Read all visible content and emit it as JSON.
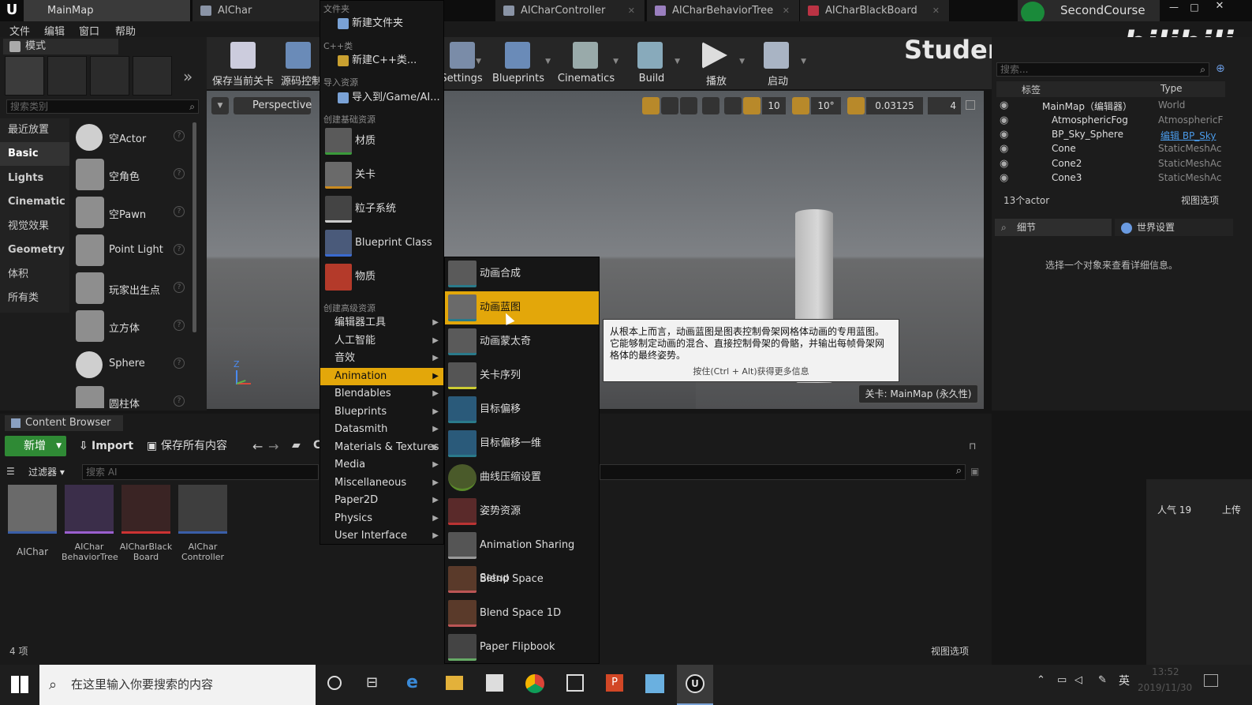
{
  "tabs": [
    {
      "label": "MainMap"
    },
    {
      "label": "AIChar"
    },
    {
      "label": "AICharController"
    },
    {
      "label": "AICharBehaviorTree"
    },
    {
      "label": "AICharBlackBoard"
    }
  ],
  "project_name": "SecondCourse",
  "menubar": {
    "file": "文件",
    "edit": "编辑",
    "window": "窗口",
    "help": "帮助"
  },
  "modes": {
    "title": "模式",
    "search_placeholder": "搜索类别",
    "categories": [
      "最近放置",
      "Basic",
      "Lights",
      "Cinematic",
      "视觉效果",
      "Geometry",
      "体积",
      "所有类"
    ],
    "items": [
      "空Actor",
      "空角色",
      "空Pawn",
      "Point Light",
      "玩家出生点",
      "立方体",
      "Sphere",
      "圆柱体"
    ]
  },
  "toolbar": {
    "buttons": [
      "保存当前关卡",
      "源码控制",
      "Settings",
      "Blueprints",
      "Cinematics",
      "Build",
      "播放",
      "启动"
    ]
  },
  "viewport": {
    "perspective": "Perspective",
    "grid_snap": "10",
    "rot_snap": "10°",
    "scale_snap": "0.03125",
    "cam_speed": "4",
    "level_label": "关卡: MainMap (永久性)",
    "axis_z": "Z"
  },
  "watermark": {
    "name": "StudentLittleRed",
    "brand": "bilibili"
  },
  "outliner": {
    "search_placeholder": "搜索...",
    "col_label": "标签",
    "col_type": "Type",
    "rows": [
      {
        "label": "MainMap（编辑器）",
        "type": "World"
      },
      {
        "label": "AtmosphericFog",
        "type": "AtmosphericF"
      },
      {
        "label": "BP_Sky_Sphere",
        "type": "编辑 BP_Sky"
      },
      {
        "label": "Cone",
        "type": "StaticMeshAc"
      },
      {
        "label": "Cone2",
        "type": "StaticMeshAc"
      },
      {
        "label": "Cone3",
        "type": "StaticMeshAc"
      }
    ],
    "count": "13个actor",
    "view_options": "视图选项"
  },
  "details": {
    "tab1": "细节",
    "tab2": "世界设置",
    "empty_msg": "选择一个对象来查看详细信息。",
    "popularity": "人气 19",
    "upload": "上传"
  },
  "content_browser": {
    "title": "Content Browser",
    "add_new": "新增",
    "import": "Import",
    "save_all": "保存所有内容",
    "filters": "过滤器",
    "search_placeholder": "搜索 AI",
    "path": "C",
    "assets": [
      {
        "name": "AIChar"
      },
      {
        "name": "AIChar BehaviorTree"
      },
      {
        "name": "AICharBlack Board"
      },
      {
        "name": "AIChar Controller"
      }
    ],
    "item_count": "4 项",
    "view_options": "视图选项"
  },
  "menu1": {
    "sec_folder": "文件夹",
    "new_folder": "新建文件夹",
    "sec_cpp": "C++类",
    "new_cpp": "新建C++类...",
    "sec_import": "导入资源",
    "import_to": "导入到/Game/AI...",
    "sec_basic": "创建基础资源",
    "basic": [
      "材质",
      "关卡",
      "粒子系统",
      "Blueprint Class",
      "物质"
    ],
    "sec_advanced": "创建高级资源",
    "advanced": [
      "编辑器工具",
      "人工智能",
      "音效",
      "Animation",
      "Blendables",
      "Blueprints",
      "Datasmith",
      "Materials & Textures",
      "Media",
      "Miscellaneous",
      "Paper2D",
      "Physics",
      "User Interface"
    ]
  },
  "menu2": {
    "items": [
      "动画合成",
      "动画蓝图",
      "动画蒙太奇",
      "关卡序列",
      "目标偏移",
      "目标偏移一维",
      "曲线压缩设置",
      "姿势资源",
      "Animation Sharing Setup",
      "Blend Space",
      "Blend Space 1D",
      "Paper Flipbook"
    ]
  },
  "tooltip": {
    "text": "从根本上而言，动画蓝图是图表控制骨架网格体动画的专用蓝图。它能够制定动画的混合、直接控制骨架的骨骼，并输出每帧骨架网格体的最终姿势。",
    "hint": "按住(Ctrl + Alt)获得更多信息"
  },
  "taskbar": {
    "search_placeholder": "在这里输入你要搜索的内容",
    "time": "13:52",
    "date": "2019/11/30",
    "ime": "英"
  }
}
